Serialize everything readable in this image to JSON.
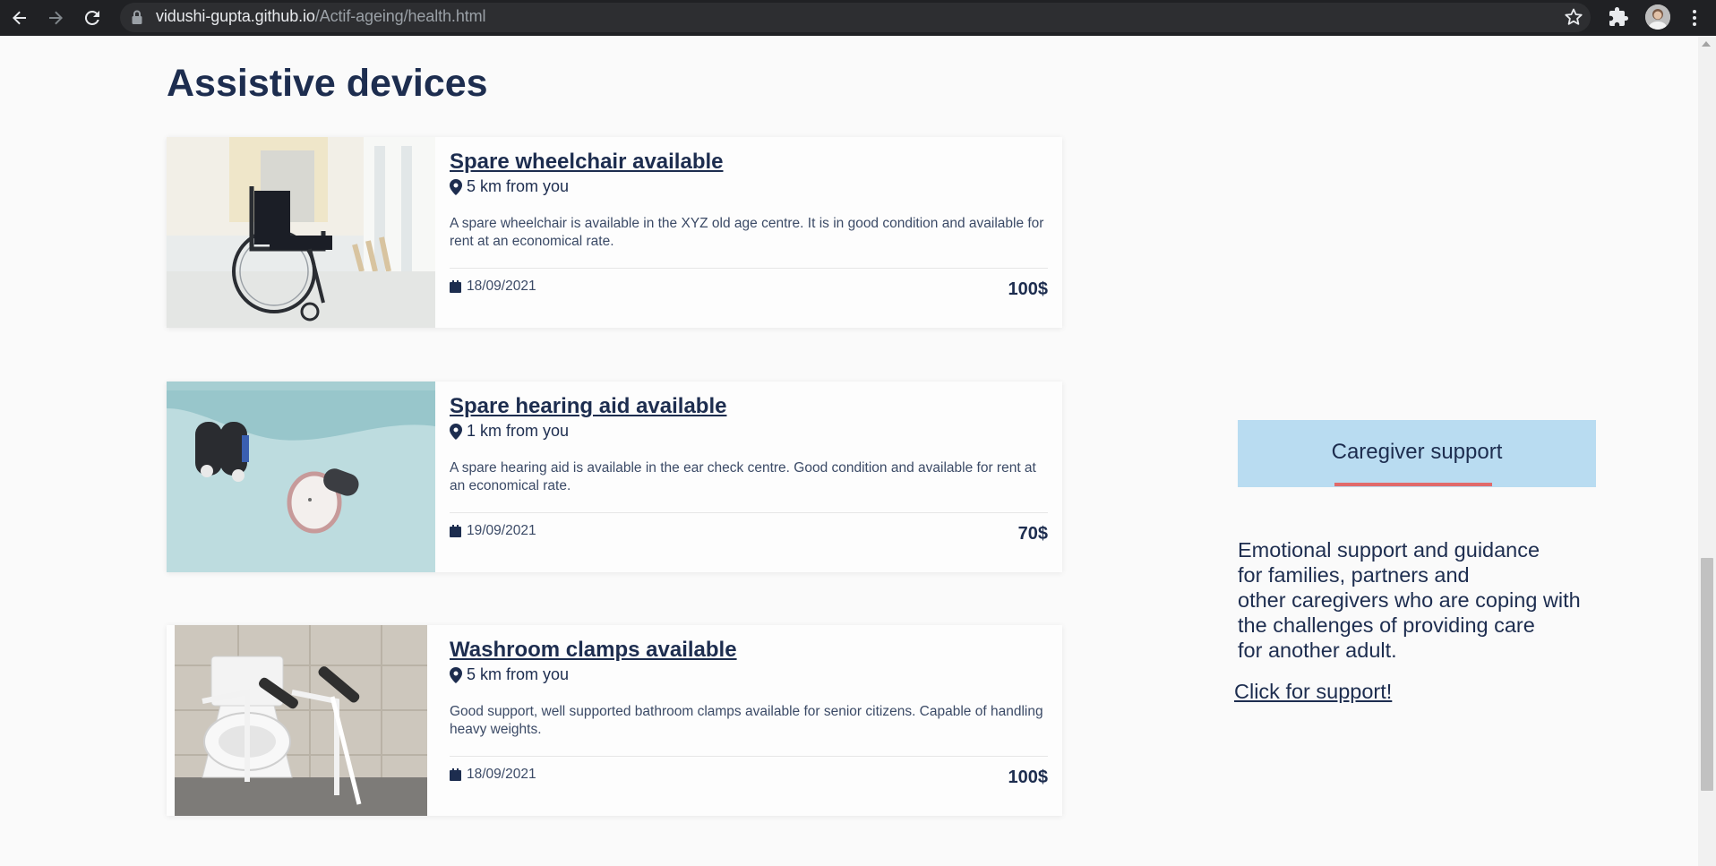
{
  "browser": {
    "url_host": "vidushi-gupta.github.io",
    "url_path": "/Actif-ageing/health.html",
    "icons": [
      "back-arrow-icon",
      "forward-arrow-icon",
      "reload-icon",
      "lock-icon",
      "star-icon",
      "puzzle-icon",
      "avatar",
      "kebab-menu-icon"
    ]
  },
  "page": {
    "section_title": "Assistive devices",
    "cards": [
      {
        "title": "Spare wheelchair available",
        "distance": "5 km from you",
        "description": "A spare wheelchair is available in the XYZ old age centre. It is in good condition and available for rent at an economical rate.",
        "date": "18/09/2021",
        "price": "100$",
        "image": "wheelchair-photo"
      },
      {
        "title": "Spare hearing aid available",
        "distance": "1 km from you",
        "description": "A spare hearing aid is available in the ear check centre. Good condition and available for rent at an economical rate.",
        "date": "19/09/2021",
        "price": "70$",
        "image": "hearing-aid-photo"
      },
      {
        "title": "Washroom clamps available",
        "distance": "5 km from you",
        "description": "Good support, well supported bathroom clamps available for senior citizens. Capable of handling heavy weights.",
        "date": "18/09/2021",
        "price": "100$",
        "image": "bathroom-clamps-photo"
      }
    ],
    "sidebar": {
      "support_title": "Caregiver support",
      "support_lines": [
        "Emotional support and guidance",
        "for families, partners and",
        "other caregivers who are coping with",
        "the challenges of providing care",
        "for another adult."
      ],
      "support_link": "Click for support!"
    }
  },
  "colors": {
    "navy": "#1d2d4f",
    "support_box": "#b9dcf1",
    "accent_underline": "#e16a6a",
    "page_bg": "#fafafa",
    "chrome_bg": "#202124"
  }
}
